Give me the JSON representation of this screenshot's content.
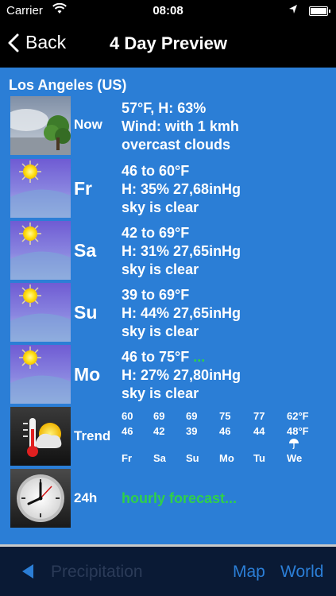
{
  "status": {
    "carrier": "Carrier",
    "time": "08:08"
  },
  "nav": {
    "back_label": "Back",
    "title": "4 Day Preview"
  },
  "city": "Los Angeles (US)",
  "rows": [
    {
      "day": "Now",
      "line1": "57°F, H: 63%",
      "line1_extra": "",
      "line2": "Wind: with 1 kmh",
      "line3": "overcast clouds",
      "icon": "cloudy-tree-icon"
    },
    {
      "day": "Fr",
      "line1": "46 to 60°F",
      "line1_extra": "",
      "line2": "H: 35% 27,68inHg",
      "line3": "sky is clear",
      "icon": "sun-icon"
    },
    {
      "day": "Sa",
      "line1": "42 to 69°F",
      "line1_extra": "",
      "line2": "H: 31% 27,65inHg",
      "line3": "sky is clear",
      "icon": "sun-icon"
    },
    {
      "day": "Su",
      "line1": "39 to 69°F",
      "line1_extra": "",
      "line2": "H: 44% 27,65inHg",
      "line3": "sky is clear",
      "icon": "sun-icon"
    },
    {
      "day": "Mo",
      "line1": "46 to 75°F",
      "line1_extra": "...",
      "line2": "H: 27% 27,80inHg",
      "line3": "sky is clear",
      "icon": "sun-icon"
    }
  ],
  "trend": {
    "label": "Trend",
    "highs": [
      "60",
      "69",
      "69",
      "75",
      "77",
      "62°F"
    ],
    "lows": [
      "46",
      "42",
      "39",
      "46",
      "44",
      "48°F"
    ],
    "days": [
      "Fr",
      "Sa",
      "Su",
      "Mo",
      "Tu",
      "We"
    ],
    "umbrella_day": "We",
    "icon": "thermometer-sun-icon"
  },
  "hourly": {
    "label": "24h",
    "link": "hourly forecast...",
    "icon": "clock-icon"
  },
  "bottom": {
    "precipitation": "Precipitation",
    "map": "Map",
    "world": "World"
  },
  "colors": {
    "accent": "#2b7ed6",
    "green": "#2fd04a",
    "background": "#2b7ed6",
    "bar": "#0a1a35"
  }
}
